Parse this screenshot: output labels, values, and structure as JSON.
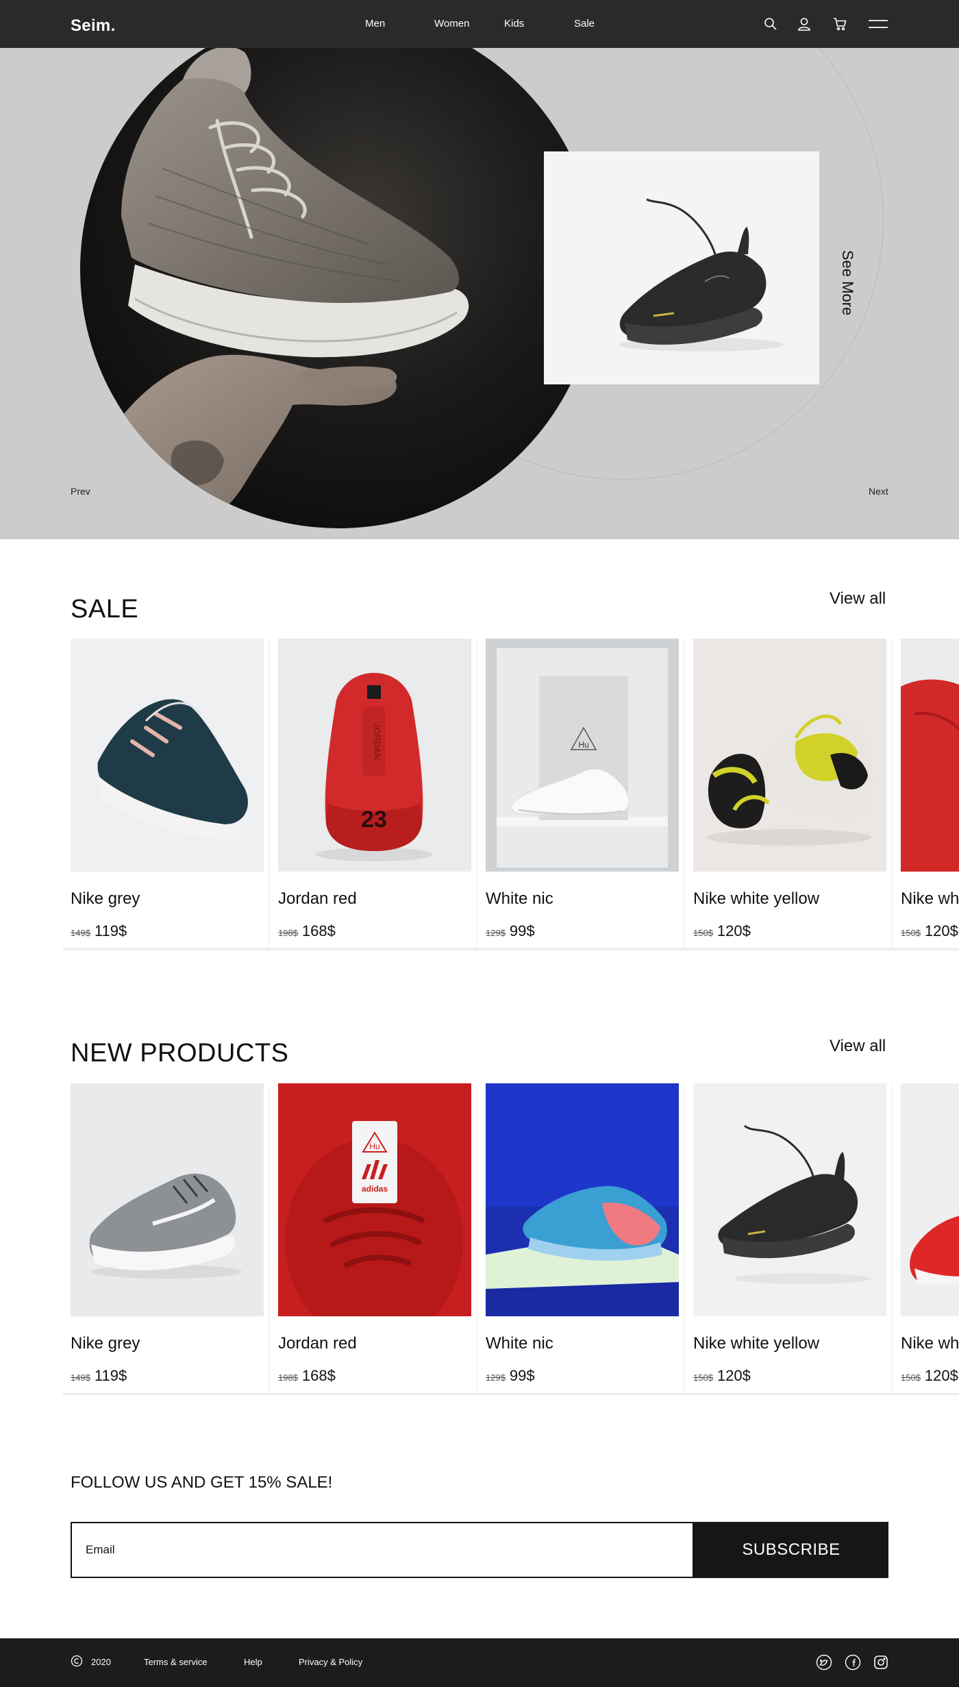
{
  "nav": {
    "logo": "Seim.",
    "links": [
      "Men",
      "Women",
      "Kids",
      "Sale"
    ],
    "icons": [
      "search-icon",
      "user-icon",
      "cart-icon",
      "menu-icon"
    ]
  },
  "hero": {
    "see_more": "See More",
    "prev": "Prev",
    "next": "Next"
  },
  "sale": {
    "title": "SALE",
    "view_all": "View all",
    "products": [
      {
        "name": "Nike grey",
        "old_price": "149$",
        "price": "119$"
      },
      {
        "name": "Jordan red",
        "old_price": "198$",
        "price": "168$"
      },
      {
        "name": "White nic",
        "old_price": "129$",
        "price": "99$"
      },
      {
        "name": "Nike white yellow",
        "old_price": "150$",
        "price": "120$"
      },
      {
        "name": "Nike white yellow",
        "old_price": "150$",
        "price": "120$"
      }
    ]
  },
  "new_products": {
    "title": "NEW PRODUCTS",
    "view_all": "View all",
    "products": [
      {
        "name": "Nike grey",
        "old_price": "149$",
        "price": "119$"
      },
      {
        "name": "Jordan red",
        "old_price": "198$",
        "price": "168$"
      },
      {
        "name": "White nic",
        "old_price": "129$",
        "price": "99$"
      },
      {
        "name": "Nike white yellow",
        "old_price": "150$",
        "price": "120$"
      },
      {
        "name": "Nike white yellow",
        "old_price": "150$",
        "price": "120$"
      }
    ]
  },
  "product_marks": {
    "jordan_number": "23",
    "jordan_text": "JORDAN",
    "hu": "Hu",
    "adidas": "adidas"
  },
  "newsletter": {
    "title": "FOLLOW US AND GET 15% SALE!",
    "email_placeholder": "Email",
    "subscribe": "SUBSCRIBE"
  },
  "footer": {
    "year": "2020",
    "links": [
      "Terms & service",
      "Help",
      "Privacy & Policy"
    ],
    "social": [
      "twitter-icon",
      "facebook-icon",
      "instagram-icon"
    ]
  },
  "colors": {
    "nav_bg": "#2a2a2a",
    "hero_bg": "#cccccc",
    "footer_bg": "#1c1c1c",
    "subscribe_bg": "#161616"
  }
}
